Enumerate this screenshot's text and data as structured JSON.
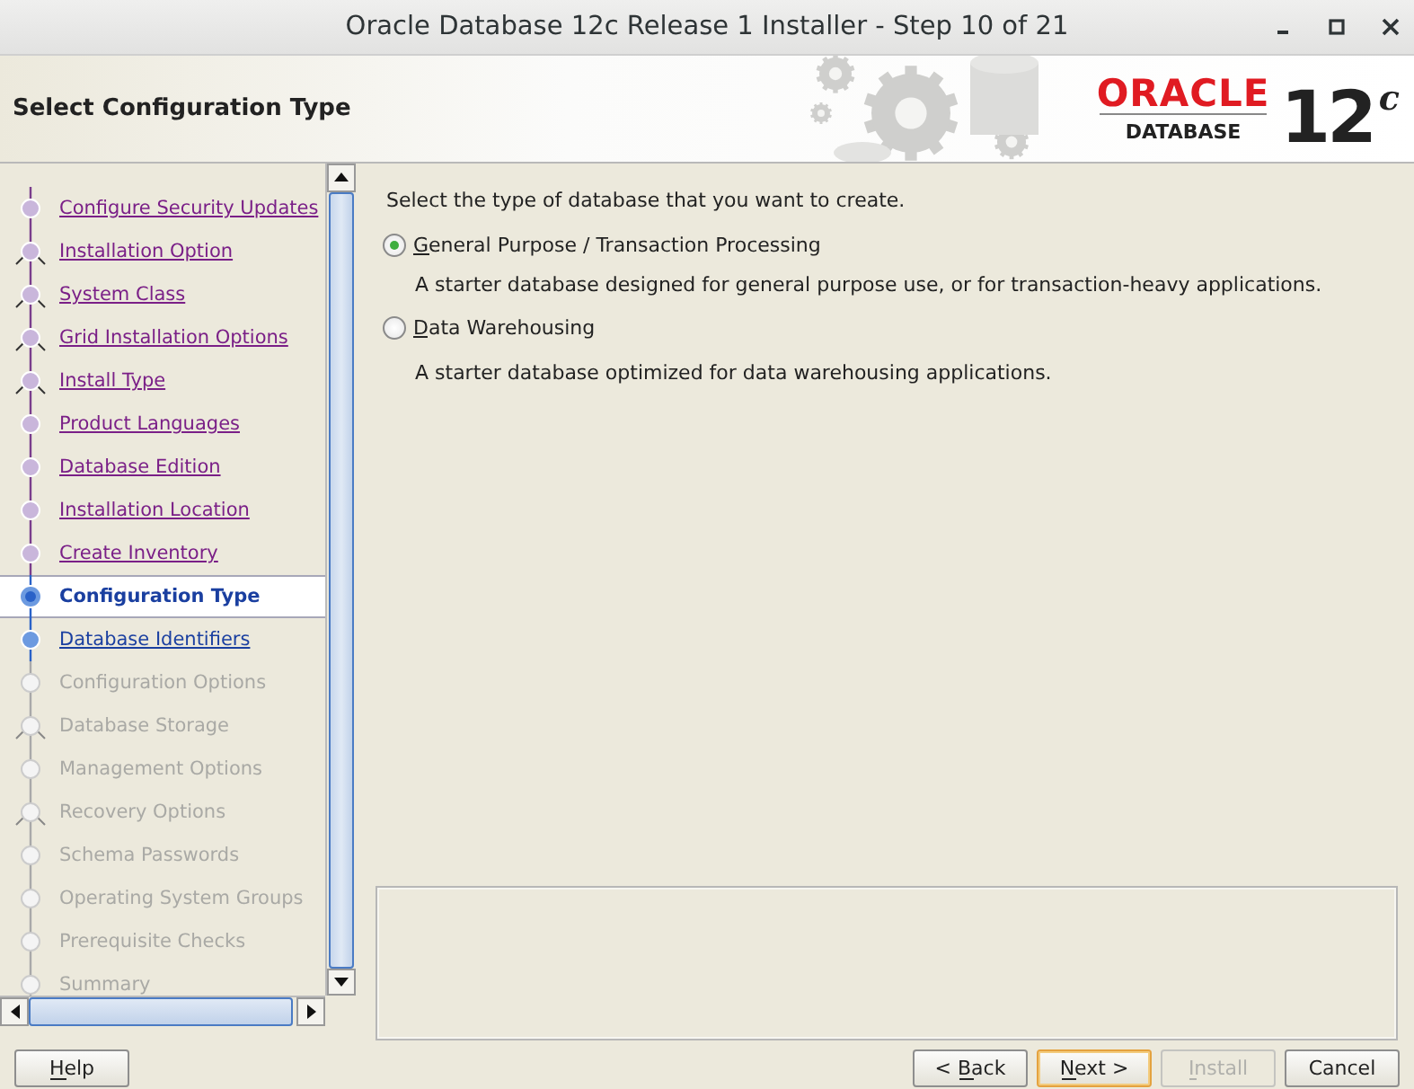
{
  "window": {
    "title": "Oracle Database 12c Release 1 Installer - Step 10 of 21"
  },
  "header": {
    "title": "Select Configuration Type",
    "brand": {
      "name": "ORACLE",
      "product": "DATABASE",
      "version": "12",
      "version_suffix": "c"
    }
  },
  "steps": [
    {
      "label": "Configure Security Updates",
      "kind": "visited",
      "branch": false
    },
    {
      "label": "Installation Option",
      "kind": "visited",
      "branch": true
    },
    {
      "label": "System Class",
      "kind": "visited",
      "branch": true
    },
    {
      "label": "Grid Installation Options",
      "kind": "visited",
      "branch": true
    },
    {
      "label": "Install Type",
      "kind": "visited",
      "branch": true
    },
    {
      "label": "Product Languages",
      "kind": "visited",
      "branch": false
    },
    {
      "label": "Database Edition",
      "kind": "visited",
      "branch": false
    },
    {
      "label": "Installation Location",
      "kind": "visited",
      "branch": false
    },
    {
      "label": "Create Inventory",
      "kind": "visited",
      "branch": false
    },
    {
      "label": "Configuration Type",
      "kind": "current",
      "branch": false
    },
    {
      "label": "Database Identifiers",
      "kind": "next",
      "branch": false
    },
    {
      "label": "Configuration Options",
      "kind": "pending",
      "branch": false
    },
    {
      "label": "Database Storage",
      "kind": "pending",
      "branch": true
    },
    {
      "label": "Management Options",
      "kind": "pending",
      "branch": false
    },
    {
      "label": "Recovery Options",
      "kind": "pending",
      "branch": true
    },
    {
      "label": "Schema Passwords",
      "kind": "pending",
      "branch": false
    },
    {
      "label": "Operating System Groups",
      "kind": "pending",
      "branch": false
    },
    {
      "label": "Prerequisite Checks",
      "kind": "pending",
      "branch": false
    },
    {
      "label": "Summary",
      "kind": "pending",
      "branch": false
    }
  ],
  "content": {
    "prompt": "Select the type of database that you want to create.",
    "options": [
      {
        "label": "General Purpose / Transaction Processing",
        "mnemonic": true,
        "selected": true,
        "description": "A starter database designed for general purpose use, or for transaction-heavy applications."
      },
      {
        "label": "Data Warehousing",
        "mnemonic": true,
        "selected": false,
        "description": "A starter database optimized for data warehousing applications."
      }
    ]
  },
  "buttons": [
    {
      "label": "Help",
      "mnemonic": true,
      "disabled": false,
      "focused": false,
      "kind": "left"
    },
    {
      "label": "< Back",
      "mnemonic": true,
      "disabled": false,
      "focused": false,
      "kind": "right"
    },
    {
      "label": "Next >",
      "mnemonic": true,
      "disabled": false,
      "focused": true,
      "kind": "right"
    },
    {
      "label": "Install",
      "mnemonic": true,
      "disabled": true,
      "focused": false,
      "kind": "right"
    },
    {
      "label": "Cancel",
      "mnemonic": false,
      "disabled": false,
      "focused": false,
      "kind": "right"
    }
  ]
}
